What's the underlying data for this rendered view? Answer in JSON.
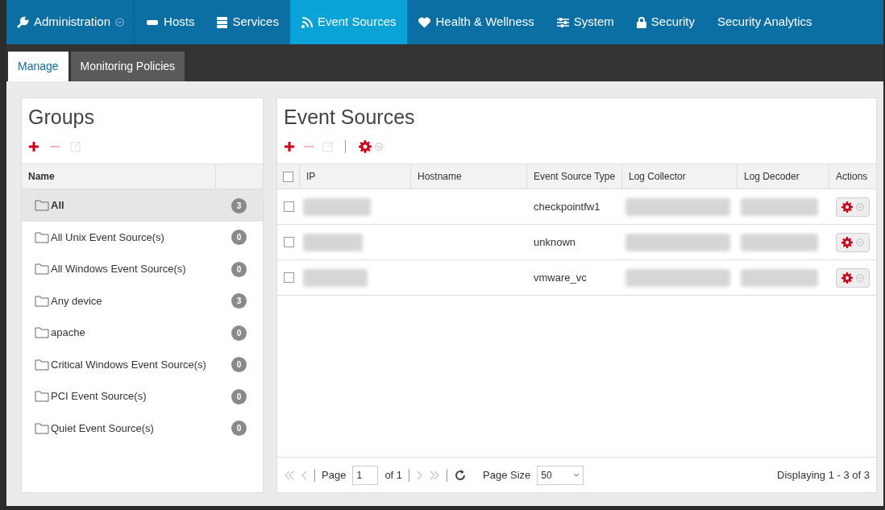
{
  "nav": [
    {
      "label": "Administration",
      "dropdown": true,
      "selected": false
    },
    {
      "label": "Hosts",
      "dropdown": false,
      "selected": false
    },
    {
      "label": "Services",
      "dropdown": false,
      "selected": false
    },
    {
      "label": "Event Sources",
      "dropdown": false,
      "selected": true
    },
    {
      "label": "Health & Wellness",
      "dropdown": false,
      "selected": false
    },
    {
      "label": "System",
      "dropdown": false,
      "selected": false
    },
    {
      "label": "Security",
      "dropdown": false,
      "selected": false
    },
    {
      "label": "Security Analytics",
      "dropdown": false,
      "selected": false
    }
  ],
  "subtabs": [
    {
      "label": "Manage",
      "selected": true
    },
    {
      "label": "Monitoring Policies",
      "selected": false
    }
  ],
  "groups": {
    "title": "Groups",
    "toolbar": [
      {
        "kind": "add"
      },
      {
        "kind": "remove",
        "disabled": true
      },
      {
        "kind": "edit",
        "disabled": true
      }
    ],
    "column": "Name",
    "items": [
      {
        "name": "All",
        "count": "3",
        "selected": true
      },
      {
        "name": "All Unix Event Source(s)",
        "count": "0",
        "selected": false
      },
      {
        "name": "All Windows Event Source(s)",
        "count": "0",
        "selected": false
      },
      {
        "name": "Any device",
        "count": "3",
        "selected": false
      },
      {
        "name": "apache",
        "count": "0",
        "selected": false
      },
      {
        "name": "Critical Windows Event Source(s)",
        "count": "0",
        "selected": false
      },
      {
        "name": "PCI Event Source(s)",
        "count": "0",
        "selected": false
      },
      {
        "name": "Quiet Event Source(s)",
        "count": "0",
        "selected": false
      }
    ]
  },
  "sources": {
    "title": "Event Sources",
    "toolbar": [
      {
        "kind": "add"
      },
      {
        "kind": "remove",
        "disabled": true
      },
      {
        "kind": "edit",
        "disabled": true
      },
      {
        "kind": "separator"
      },
      {
        "kind": "gear"
      }
    ],
    "select_all_checked": false,
    "columns": [
      "IP",
      "Hostname",
      "Event Source Type",
      "Log Collector",
      "Log Decoder",
      "Actions"
    ],
    "rows": [
      {
        "checked": false,
        "type": "checkpointfw1"
      },
      {
        "checked": false,
        "type": "unknown"
      },
      {
        "checked": false,
        "type": "vmware_vc"
      }
    ],
    "pager": {
      "page_label": "Page",
      "page": "1",
      "of": "of 1",
      "size_label": "Page Size",
      "size": "50",
      "display": "Displaying 1 - 3 of 3"
    }
  }
}
